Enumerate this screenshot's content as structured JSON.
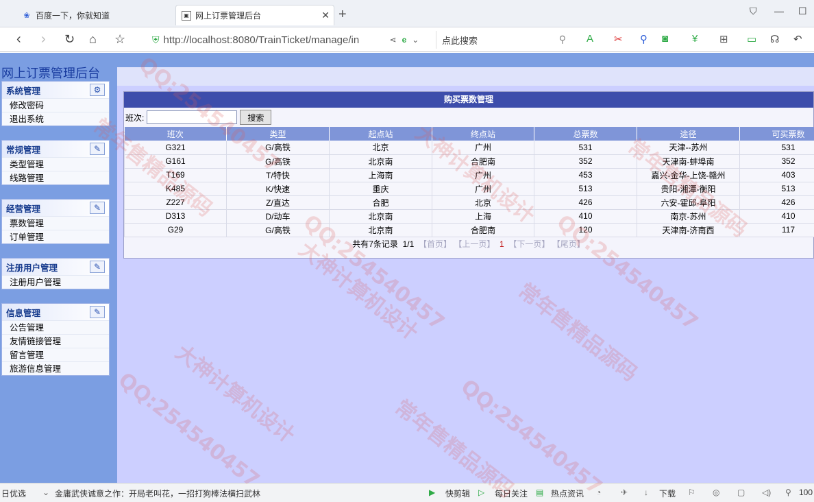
{
  "browser": {
    "tabs": [
      {
        "label": "百度一下，你就知道",
        "icon": "paw-icon"
      },
      {
        "label": "网上订票管理后台",
        "icon": "page-icon"
      }
    ],
    "url": "http://localhost:8080/TrainTicket/manage/in",
    "search_placeholder": "点此搜索"
  },
  "app": {
    "title": "网上订票管理后台",
    "menus": [
      {
        "title": "系统管理",
        "items": [
          "修改密码",
          "退出系统"
        ]
      },
      {
        "title": "常规管理",
        "items": [
          "类型管理",
          "线路管理"
        ]
      },
      {
        "title": "经营管理",
        "items": [
          "票数管理",
          "订单管理"
        ]
      },
      {
        "title": "注册用户管理",
        "items": [
          "注册用户管理"
        ]
      },
      {
        "title": "信息管理",
        "items": [
          "公告管理",
          "友情链接管理",
          "留言管理",
          "旅游信息管理"
        ]
      }
    ]
  },
  "panel": {
    "title": "购买票数管理",
    "search_label": "班次:",
    "search_value": "",
    "search_button": "搜索",
    "columns": [
      "班次",
      "类型",
      "起点站",
      "终点站",
      "总票数",
      "途径",
      "可买票数"
    ],
    "rows": [
      [
        "G321",
        "G/高铁",
        "北京",
        "广州",
        "531",
        "天津--苏州",
        "531"
      ],
      [
        "G161",
        "G/高铁",
        "北京南",
        "合肥南",
        "352",
        "天津南-蚌埠南",
        "352"
      ],
      [
        "T169",
        "T/特快",
        "上海南",
        "广州",
        "453",
        "嘉兴-金华-上饶-赣州",
        "403"
      ],
      [
        "K485",
        "K/快速",
        "重庆",
        "广州",
        "513",
        "贵阳-湘潭-衡阳",
        "513"
      ],
      [
        "Z227",
        "Z/直达",
        "合肥",
        "北京",
        "426",
        "六安-霍邱-阜阳",
        "426"
      ],
      [
        "D313",
        "D/动车",
        "北京南",
        "上海",
        "410",
        "南京-苏州",
        "410"
      ],
      [
        "G29",
        "G/高铁",
        "北京南",
        "合肥南",
        "120",
        "天津南-济南西",
        "117"
      ]
    ],
    "pager": {
      "summary": "共有7条记录",
      "page": "1/1",
      "first": "【首页】",
      "prev": "【上一页】",
      "current": "1",
      "next": "【下一页】",
      "last": "【尾页】"
    }
  },
  "statusbar": {
    "left": "日优选",
    "news": "金庸武侠诚意之作：开局老叫花，一招打狗棒法横扫武林",
    "items": [
      "快剪辑",
      "每日关注",
      "热点资讯",
      "下载"
    ],
    "zoom": "100"
  },
  "watermarks": [
    "QQ:254540457",
    "大神计算机设计",
    "常年售精品源码"
  ]
}
